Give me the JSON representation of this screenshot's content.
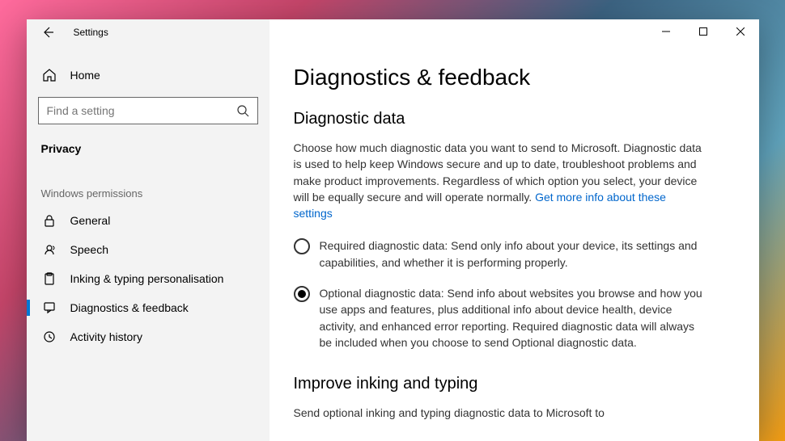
{
  "app": {
    "title": "Settings"
  },
  "sidebar": {
    "home": "Home",
    "search": {
      "placeholder": "Find a setting"
    },
    "category": "Privacy",
    "section_header": "Windows permissions",
    "items": [
      {
        "label": "General",
        "icon": "lock-icon"
      },
      {
        "label": "Speech",
        "icon": "speech-icon"
      },
      {
        "label": "Inking & typing personalisation",
        "icon": "clipboard-icon"
      },
      {
        "label": "Diagnostics & feedback",
        "icon": "feedback-icon"
      },
      {
        "label": "Activity history",
        "icon": "history-icon"
      }
    ]
  },
  "page": {
    "title": "Diagnostics & feedback",
    "diagnostic": {
      "heading": "Diagnostic data",
      "intro": "Choose how much diagnostic data you want to send to Microsoft. Diagnostic data is used to help keep Windows secure and up to date, troubleshoot problems and make product improvements. Regardless of which option you select, your device will be equally secure and will operate normally. ",
      "link": "Get more info about these settings",
      "option_required": "Required diagnostic data: Send only info about your device, its settings and capabilities, and whether it is performing properly.",
      "option_optional": "Optional diagnostic data: Send info about websites you browse and how you use apps and features, plus additional info about device health, device activity, and enhanced error reporting. Required diagnostic data will always be included when you choose to send Optional diagnostic data.",
      "selected": "optional"
    },
    "improve": {
      "heading": "Improve inking and typing",
      "body": "Send optional inking and typing diagnostic data to Microsoft to"
    }
  }
}
